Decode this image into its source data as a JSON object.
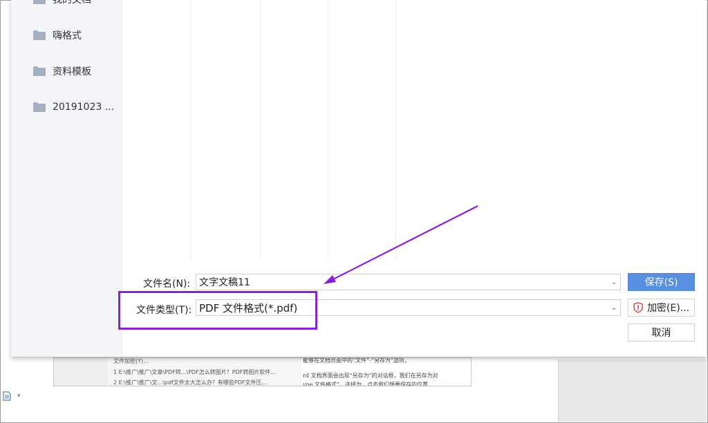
{
  "sidebar": {
    "items": [
      {
        "label": "我的文档"
      },
      {
        "label": "嗨格式"
      },
      {
        "label": "资料模板"
      },
      {
        "label": "20191023 ..."
      }
    ]
  },
  "form": {
    "filename_label": "文件名(N):",
    "filename_value": "文字文稿11",
    "filetype_label": "文件类型(T):",
    "filetype_value": "PDF 文件格式(*.pdf)"
  },
  "buttons": {
    "save": "保存(S)",
    "encrypt": "加密(E)...",
    "cancel": "取消"
  },
  "background_doc": {
    "thumb_lines": [
      "文件加密(Y)...",
      "1 E:\\推广\\推广\\文章\\PDF转...\\PDF怎么转图片？PDF转图片软件...",
      "2 E:\\推广\\推广\\文...\\pdf文件太大怎么办？有哪些PDF文件压..."
    ],
    "doc_lines": [
      "能够在文档页面中的“文件”-“另存为”选项，",
      "rd 文档界面会出现“另存为”的对话框，我们在另存为对",
      "ype 文件格式”，选择为，点击我们想要保存的位置"
    ]
  },
  "colors": {
    "accent": "#5a8fe0",
    "annotation": "#8b1fd6",
    "sidebar_bg": "#f3f5f9"
  }
}
